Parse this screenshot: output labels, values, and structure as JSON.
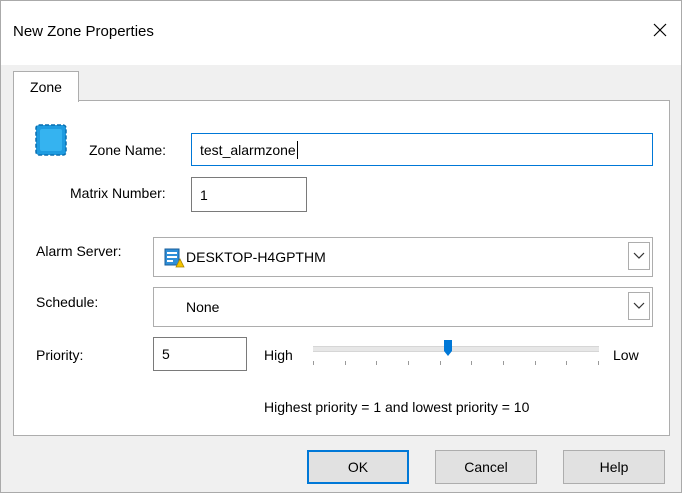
{
  "window": {
    "title": "New Zone Properties",
    "close_icon": "close-icon"
  },
  "tabs": [
    {
      "label": "Zone",
      "selected": true
    }
  ],
  "zone_icon": "zone-square-icon",
  "zone_name": {
    "label": "Zone Name:",
    "value": "test_alarmzone"
  },
  "matrix_number": {
    "label": "Matrix Number:",
    "value": "1"
  },
  "alarm_server": {
    "label": "Alarm Server:",
    "value": "DESKTOP-H4GPTHM",
    "icon": "alarm-server-icon"
  },
  "schedule": {
    "label": "Schedule:",
    "value": "None"
  },
  "priority": {
    "label": "Priority:",
    "value": "5",
    "high_label": "High",
    "low_label": "Low",
    "slider_level": 5,
    "slider_min": 1,
    "slider_max": 10,
    "hint": "Highest priority = 1 and lowest priority = 10"
  },
  "buttons": {
    "ok": "OK",
    "cancel": "Cancel",
    "help": "Help"
  },
  "colors": {
    "accent": "#0078d7",
    "icon_blue": "#1e9be0"
  }
}
